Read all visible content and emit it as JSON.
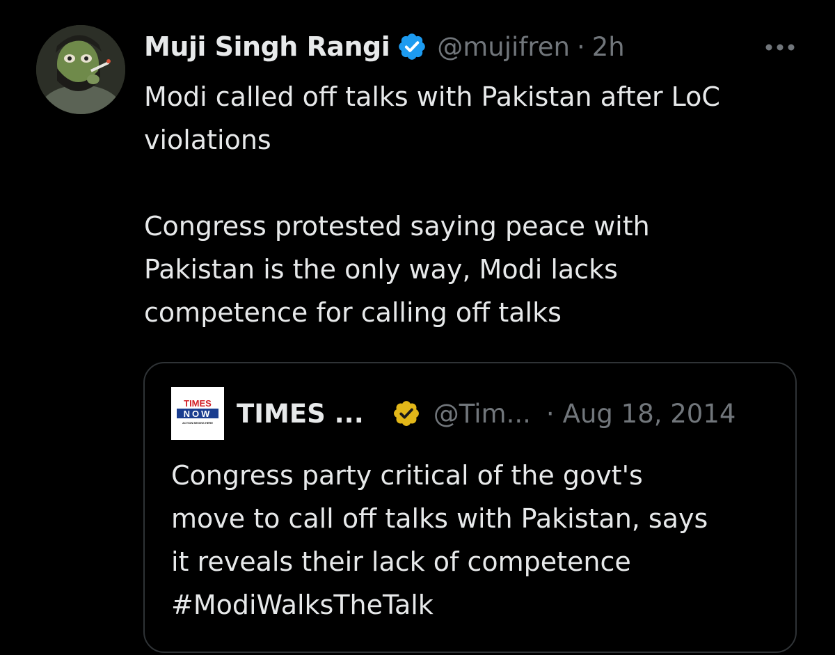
{
  "author": {
    "display_name": "Muji Singh Rangi",
    "handle": "@mujifren",
    "separator": "·",
    "time": "2h",
    "verified_color": "#1d9bf0"
  },
  "tweet": {
    "lines": [
      "Modi called off talks with Pakistan after LoC",
      "violations",
      "Congress protested saying peace with",
      "Pakistan is the only way, Modi lacks",
      "competence for calling off talks"
    ]
  },
  "quoted": {
    "display_name": "TIMES ...",
    "handle": "@Tim...",
    "separator": "·",
    "date": "Aug 18, 2014",
    "badge_color": "#e2b719",
    "logo_text_top": "TIMES",
    "logo_text_bottom": "NOW",
    "logo_tagline": "ACTION BEGINS HERE",
    "lines": [
      "Congress party critical of the govt's",
      "move to call off talks with Pakistan, says",
      "it reveals their lack of competence",
      "#ModiWalksTheTalk"
    ]
  },
  "icons": {
    "more": "more-horizontal-icon",
    "verified": "verified-badge-icon",
    "org_verified": "gold-verified-badge-icon"
  },
  "colors": {
    "background": "#000000",
    "text_primary": "#e7e9ea",
    "text_secondary": "#71767b",
    "border": "#2f3336"
  }
}
